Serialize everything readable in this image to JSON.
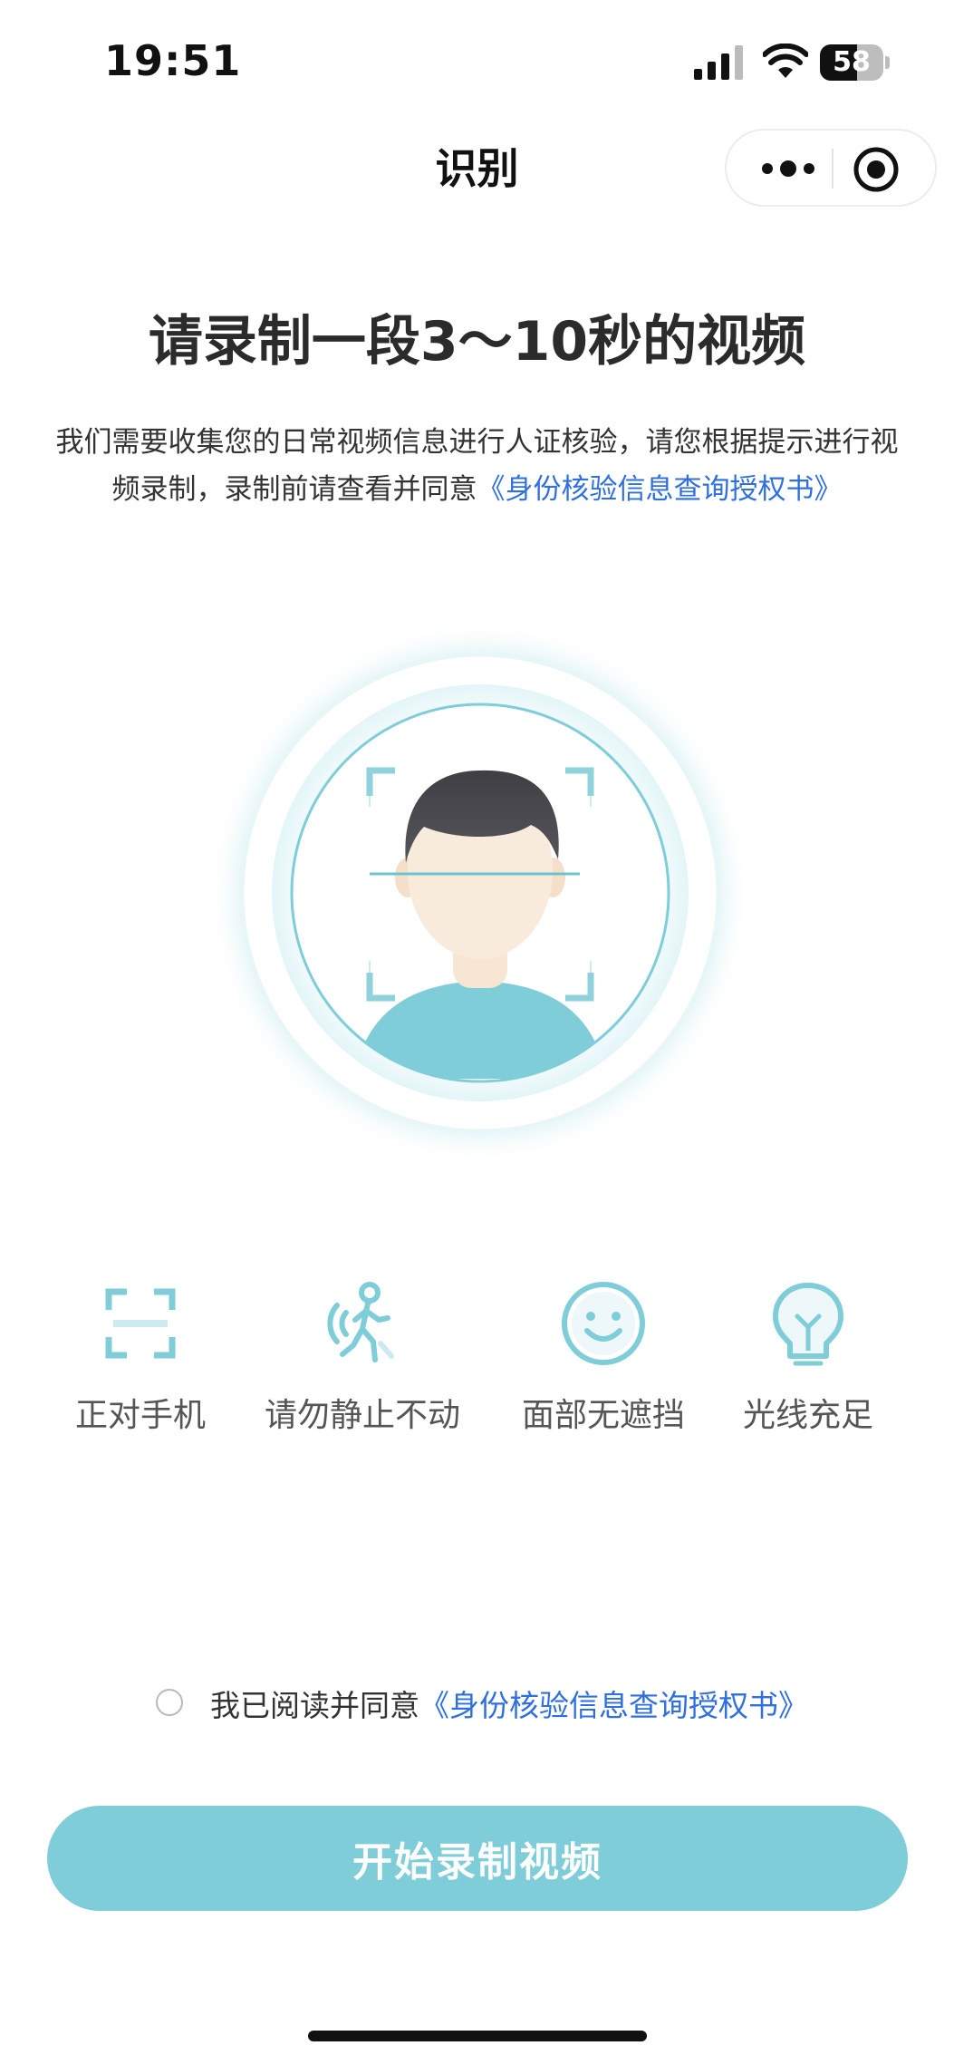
{
  "status_bar": {
    "time": "19:51",
    "battery_level": "58",
    "battery_fraction": 0.58,
    "icons": [
      "signal-icon",
      "wifi-icon",
      "battery-icon"
    ]
  },
  "nav": {
    "title": "识别",
    "capsule_icons": [
      "more-icon",
      "close-target-icon"
    ]
  },
  "heading": "请录制一段3～10秒的视频",
  "description": {
    "text": "我们需要收集您的日常视频信息进行人证核验，请您根据提示进行视频录制，录制前请查看并同意",
    "link": "《身份核验信息查询授权书》"
  },
  "illustration": {
    "icon": "face-scan-avatar-icon"
  },
  "tips": [
    {
      "label": "正对手机",
      "icon": "scan-frame-icon"
    },
    {
      "label": "请勿静止不动",
      "icon": "walking-person-icon"
    },
    {
      "label": "面部无遮挡",
      "icon": "smiley-face-icon"
    },
    {
      "label": "光线充足",
      "icon": "light-bulb-icon"
    }
  ],
  "agreement": {
    "prefix": "我已阅读并同意",
    "link": "《身份核验信息查询授权书》",
    "checked": false
  },
  "button": {
    "label": "开始录制视频"
  },
  "colors": {
    "accent": "#7ecdd8",
    "link": "#2f6fe0",
    "icon_teal": "#6cc3cf"
  }
}
